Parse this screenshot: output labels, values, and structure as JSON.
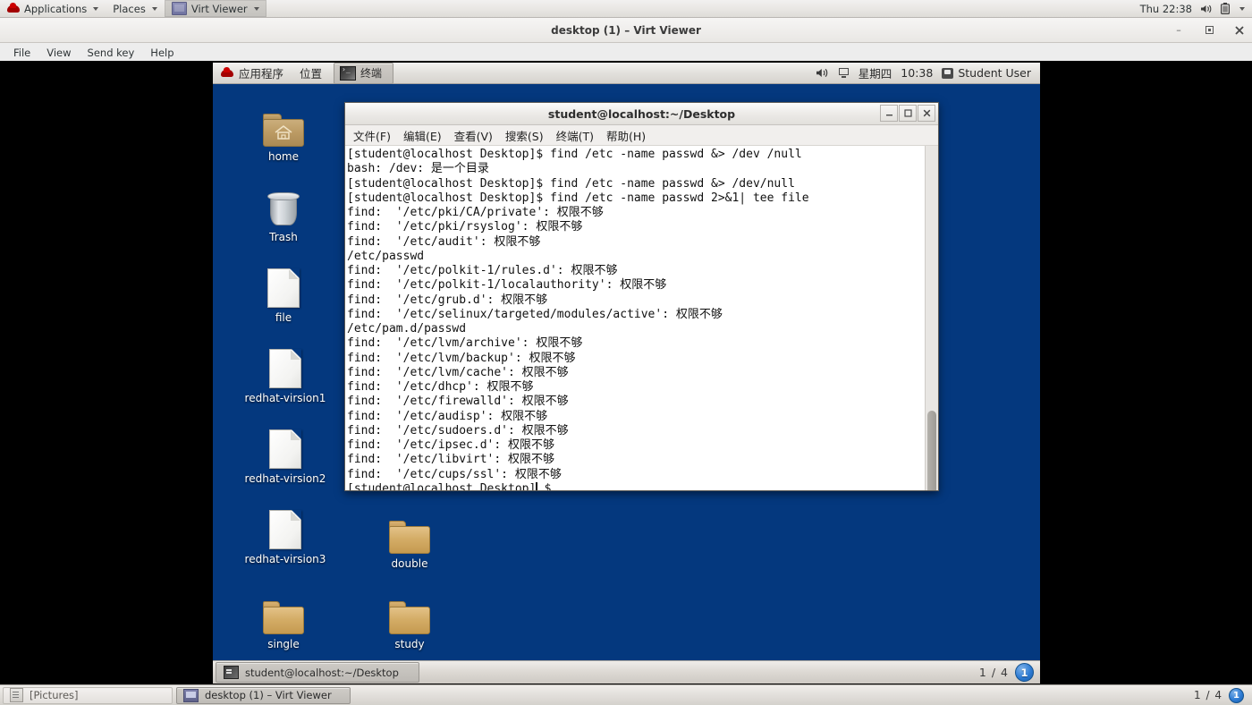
{
  "host_panel": {
    "applications_label": "Applications",
    "places_label": "Places",
    "app_label": "Virt Viewer",
    "clock": "Thu 22:38",
    "icons": [
      "redhat-logo",
      "speaker-icon",
      "battery-icon",
      "chevron-down-icon"
    ]
  },
  "virt_viewer": {
    "title": "desktop (1) – Virt Viewer",
    "menus": [
      "File",
      "View",
      "Send key",
      "Help"
    ],
    "window_buttons": {
      "minimize": "–",
      "maximize": "❐",
      "close": "✕"
    }
  },
  "vm_panel": {
    "applications_label": "应用程序",
    "places_label": "位置",
    "task_label": "终端",
    "clock_day": "星期四",
    "clock_time": "10:38",
    "user_label": "Student User"
  },
  "desktop_icons": [
    {
      "label": "home",
      "type": "home-folder"
    },
    {
      "label": "Trash",
      "type": "trash"
    },
    {
      "label": "file",
      "type": "file"
    },
    {
      "label": "redhat-virsion1",
      "type": "file"
    },
    {
      "label": "redhat-virsion2",
      "type": "file"
    },
    {
      "label": "redhat-virsion3",
      "type": "file"
    },
    {
      "label": "double",
      "type": "folder"
    },
    {
      "label": "single",
      "type": "folder"
    },
    {
      "label": "study",
      "type": "folder"
    }
  ],
  "terminal": {
    "title": "student@localhost:~/Desktop",
    "menus": [
      "文件(F)",
      "编辑(E)",
      "查看(V)",
      "搜索(S)",
      "终端(T)",
      "帮助(H)"
    ],
    "window_buttons": {
      "minimize": "_",
      "maximize": "□",
      "close": "✕"
    },
    "lines": [
      "[student@localhost Desktop]$ find /etc -name passwd &> /dev /null",
      "bash: /dev: 是一个目录",
      "[student@localhost Desktop]$ find /etc -name passwd &> /dev/null",
      "[student@localhost Desktop]$ find /etc -name passwd 2>&1| tee file",
      "find:  '/etc/pki/CA/private': 权限不够",
      "find:  '/etc/pki/rsyslog': 权限不够",
      "find:  '/etc/audit': 权限不够",
      "/etc/passwd",
      "find:  '/etc/polkit-1/rules.d': 权限不够",
      "find:  '/etc/polkit-1/localauthority': 权限不够",
      "find:  '/etc/grub.d': 权限不够",
      "find:  '/etc/selinux/targeted/modules/active': 权限不够",
      "/etc/pam.d/passwd",
      "find:  '/etc/lvm/archive': 权限不够",
      "find:  '/etc/lvm/backup': 权限不够",
      "find:  '/etc/lvm/cache': 权限不够",
      "find:  '/etc/dhcp': 权限不够",
      "find:  '/etc/firewalld': 权限不够",
      "find:  '/etc/audisp': 权限不够",
      "find:  '/etc/sudoers.d': 权限不够",
      "find:  '/etc/ipsec.d': 权限不够",
      "find:  '/etc/libvirt': 权限不够",
      "find:  '/etc/cups/ssl': 权限不够"
    ],
    "prompt": "[student@localhost Desktop]",
    "prompt_suffix": "$"
  },
  "vm_taskbar": {
    "task_label": "student@localhost:~/Desktop",
    "workspace_label": "1 / 4",
    "workspace_number": "1"
  },
  "host_taskbar": {
    "items": [
      {
        "label": "[Pictures]",
        "icon": "pictures-icon",
        "active": false
      },
      {
        "label": "desktop (1) – Virt Viewer",
        "icon": "virt-viewer-icon",
        "active": true
      }
    ],
    "workspace_label": "1 / 4",
    "workspace_number": "1"
  },
  "colors": {
    "desktop_blue": "#04387e",
    "panel_grey": "#e3e1dd",
    "terminal_bg": "#ffffff",
    "accent_blue": "#2d7bd4"
  }
}
